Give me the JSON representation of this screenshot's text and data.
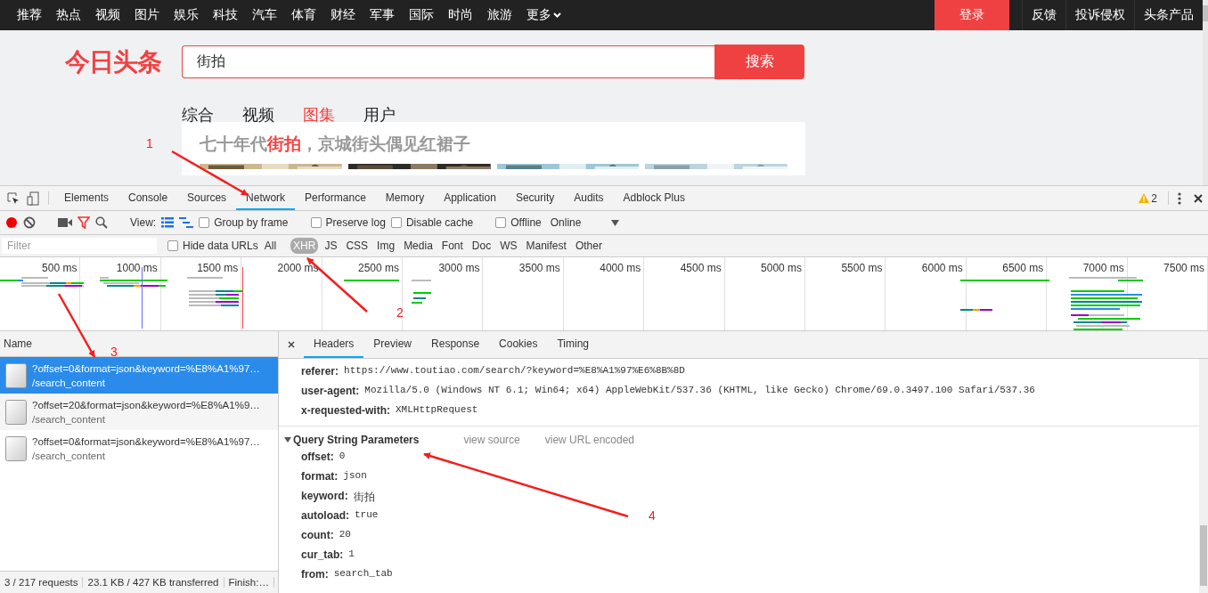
{
  "top_nav": {
    "items": [
      "推荐",
      "热点",
      "视频",
      "图片",
      "娱乐",
      "科技",
      "汽车",
      "体育",
      "财经",
      "军事",
      "国际",
      "时尚",
      "旅游"
    ],
    "more": "更多",
    "login": "登录",
    "links": [
      "反馈",
      "投诉侵权",
      "头条产品"
    ]
  },
  "logo": "今日头条",
  "search": {
    "value": "街拍",
    "button": "搜索"
  },
  "result_tabs": [
    {
      "label": "综合",
      "selected": false
    },
    {
      "label": "视频",
      "selected": false
    },
    {
      "label": "图集",
      "selected": true
    },
    {
      "label": "用户",
      "selected": false
    }
  ],
  "result_card": {
    "title_parts": [
      {
        "text": "七十年代",
        "highlighted": false
      },
      {
        "text": "街拍",
        "highlighted": true
      },
      {
        "text": "，京城街头偶见红裙子",
        "highlighted": false
      }
    ]
  },
  "devtools": {
    "tabs": [
      {
        "label": "Elements",
        "selected": false
      },
      {
        "label": "Console",
        "selected": false
      },
      {
        "label": "Sources",
        "selected": false
      },
      {
        "label": "Network",
        "selected": true
      },
      {
        "label": "Performance",
        "selected": false
      },
      {
        "label": "Memory",
        "selected": false
      },
      {
        "label": "Application",
        "selected": false
      },
      {
        "label": "Security",
        "selected": false
      },
      {
        "label": "Audits",
        "selected": false
      },
      {
        "label": "Adblock Plus",
        "selected": false
      }
    ],
    "warning_count": "2",
    "toolbar": {
      "recording": true,
      "view_label": "View:",
      "checkboxes": [
        {
          "label": "Group by frame",
          "checked": false
        },
        {
          "label": "Preserve log",
          "checked": false
        },
        {
          "label": "Disable cache",
          "checked": false
        },
        {
          "label": "Offline",
          "checked": false
        }
      ],
      "throttling": "Online"
    },
    "filter": {
      "placeholder": "Filter",
      "hide_data_urls": {
        "label": "Hide data URLs",
        "checked": false
      },
      "types": [
        {
          "label": "All",
          "selected": false
        },
        {
          "label": "XHR",
          "selected": true
        },
        {
          "label": "JS",
          "selected": false
        },
        {
          "label": "CSS",
          "selected": false
        },
        {
          "label": "Img",
          "selected": false
        },
        {
          "label": "Media",
          "selected": false
        },
        {
          "label": "Font",
          "selected": false
        },
        {
          "label": "Doc",
          "selected": false
        },
        {
          "label": "WS",
          "selected": false
        },
        {
          "label": "Manifest",
          "selected": false
        },
        {
          "label": "Other",
          "selected": false
        }
      ]
    },
    "timeline_ticks": [
      "500 ms",
      "1000 ms",
      "1500 ms",
      "2000 ms",
      "2500 ms",
      "3000 ms",
      "3500 ms",
      "4000 ms",
      "4500 ms",
      "5000 ms",
      "5500 ms",
      "6000 ms",
      "6500 ms",
      "7000 ms",
      "7500 ms"
    ],
    "requests": {
      "column": "Name",
      "rows": [
        {
          "query": "?offset=0&format=json&keyword=%E8%A1%97…",
          "path": "/search_content",
          "selected": true
        },
        {
          "query": "?offset=20&format=json&keyword=%E8%A1%9…",
          "path": "/search_content",
          "selected": false
        },
        {
          "query": "?offset=0&format=json&keyword=%E8%A1%97…",
          "path": "/search_content",
          "selected": false
        }
      ]
    },
    "status": [
      "3 / 217 requests",
      "23.1 KB / 427 KB transferred",
      "Finish:…"
    ],
    "detail_tabs": [
      {
        "label": "Headers",
        "selected": true
      },
      {
        "label": "Preview",
        "selected": false
      },
      {
        "label": "Response",
        "selected": false
      },
      {
        "label": "Cookies",
        "selected": false
      },
      {
        "label": "Timing",
        "selected": false
      }
    ],
    "request_headers": [
      {
        "name": "referer:",
        "value": "https://www.toutiao.com/search/?keyword=%E8%A1%97%E6%8B%8D"
      },
      {
        "name": "user-agent:",
        "value": "Mozilla/5.0 (Windows NT 6.1; Win64; x64) AppleWebKit/537.36 (KHTML, like Gecko) Chrome/69.0.3497.100 Safari/537.36"
      },
      {
        "name": "x-requested-with:",
        "value": "XMLHttpRequest"
      }
    ],
    "query_params": {
      "title": "Query String Parameters",
      "expanded": true,
      "links": [
        "view source",
        "view URL encoded"
      ],
      "params": [
        {
          "name": "offset:",
          "value": "0"
        },
        {
          "name": "format:",
          "value": "json"
        },
        {
          "name": "keyword:",
          "value": "街拍"
        },
        {
          "name": "autoload:",
          "value": "true"
        },
        {
          "name": "count:",
          "value": "20"
        },
        {
          "name": "cur_tab:",
          "value": "1"
        },
        {
          "name": "from:",
          "value": "search_tab"
        }
      ]
    }
  },
  "annotations": [
    {
      "label": "1"
    },
    {
      "label": "2"
    },
    {
      "label": "3"
    },
    {
      "label": "4"
    }
  ]
}
